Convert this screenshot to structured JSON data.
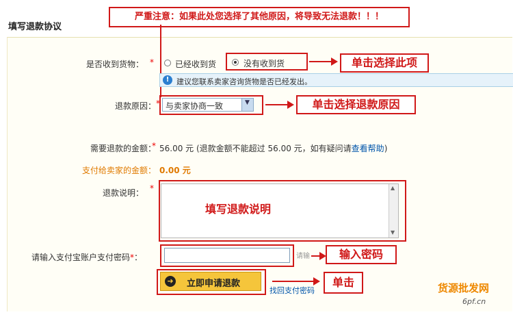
{
  "page": {
    "title": "填写退款协议"
  },
  "warning": {
    "text": "严重注意：如果此处您选择了其他原因，将导致无法退款！！！"
  },
  "goods_received": {
    "label": "是否收到货物：",
    "options": [
      {
        "label": "已经收到货",
        "checked": false
      },
      {
        "label": "没有收到货",
        "checked": true
      }
    ],
    "hint": "建议您联系卖家咨询货物是否已经发出。"
  },
  "refund_reason": {
    "label": "退款原因：",
    "selected": "与卖家协商一致"
  },
  "refund_amount": {
    "label": "需要退款的金额：",
    "value": "56.00 元",
    "note_prefix": "(退款金额不能超过 56.00 元，如有疑问请",
    "help_link": "查看帮助",
    "note_suffix": ")"
  },
  "seller_amount": {
    "label": "支付给卖家的金额：",
    "value": "0.00 元"
  },
  "refund_note": {
    "label": "退款说明："
  },
  "password": {
    "label": "请输入支付宝账户支付密码",
    "label_suffix": "：",
    "side_text": "请输"
  },
  "submit": {
    "label": "立即申请退款"
  },
  "find_password_link": "找回支付密码",
  "annotations": {
    "select_option": "单击选择此项",
    "select_reason": "单击选择退款原因",
    "fill_note": "填写退款说明",
    "enter_password": "输入密码",
    "click": "单击"
  },
  "watermark": {
    "text1": "货源批发网",
    "text2": "6pf.cn"
  },
  "required_mark": "*",
  "colors": {
    "annotation_red": "#d01818",
    "accent_orange": "#e07a00",
    "button_yellow": "#f5c53b",
    "link_blue": "#0055aa"
  }
}
